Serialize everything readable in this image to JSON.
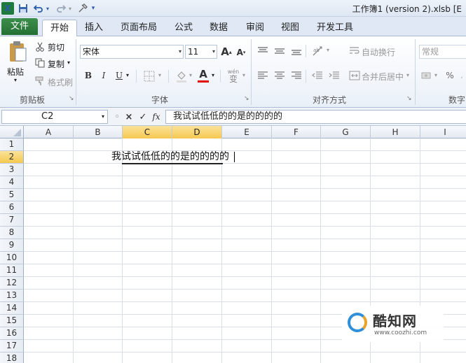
{
  "window": {
    "title": "工作簿1 (version 2).xlsb [E",
    "quick_access": [
      "excel-logo",
      "save-icon",
      "undo-icon",
      "redo-icon",
      "customize-icon"
    ],
    "excel_logo_letter": "X"
  },
  "tabs": [
    {
      "label": "文件"
    },
    {
      "label": "开始"
    },
    {
      "label": "插入"
    },
    {
      "label": "页面布局"
    },
    {
      "label": "公式"
    },
    {
      "label": "数据"
    },
    {
      "label": "审阅"
    },
    {
      "label": "视图"
    },
    {
      "label": "开发工具"
    }
  ],
  "ribbon": {
    "clipboard": {
      "paste": "粘贴",
      "cut": "剪切",
      "copy": "复制",
      "format_painter": "格式刷",
      "group_label": "剪贴板"
    },
    "font": {
      "font_name": "宋体",
      "font_size": "11",
      "grow": "A",
      "shrink": "A",
      "bold": "B",
      "italic": "I",
      "underline": "U",
      "font_color_letter": "A",
      "wen": "wén",
      "wen_char": "变",
      "group_label": "字体"
    },
    "alignment": {
      "wrap_text": "自动换行",
      "merge_center": "合并后居中",
      "group_label": "对齐方式"
    },
    "number": {
      "format": "常规",
      "percent": "%",
      "group_label": "数字"
    }
  },
  "formula_bar": {
    "name_box": "C2",
    "cancel": "×",
    "enter": "✓",
    "fx": "fx",
    "content": "我试试低低的的是的的的的"
  },
  "grid": {
    "columns": [
      "A",
      "B",
      "C",
      "D",
      "E",
      "F",
      "G",
      "H",
      "I"
    ],
    "rows": [
      "1",
      "2",
      "3",
      "4",
      "5",
      "6",
      "7",
      "8",
      "9",
      "10",
      "11",
      "12",
      "13",
      "14",
      "15",
      "16",
      "17",
      "18"
    ],
    "active_cell_text": "我试试低低的的是的的的的"
  },
  "watermark": {
    "name": "酷知网",
    "url": "www.coozhi.com"
  },
  "colors": {
    "file_tab": "#2e7d3e",
    "selection_header": "#f5c850",
    "font_color_bar": "#e00000"
  }
}
